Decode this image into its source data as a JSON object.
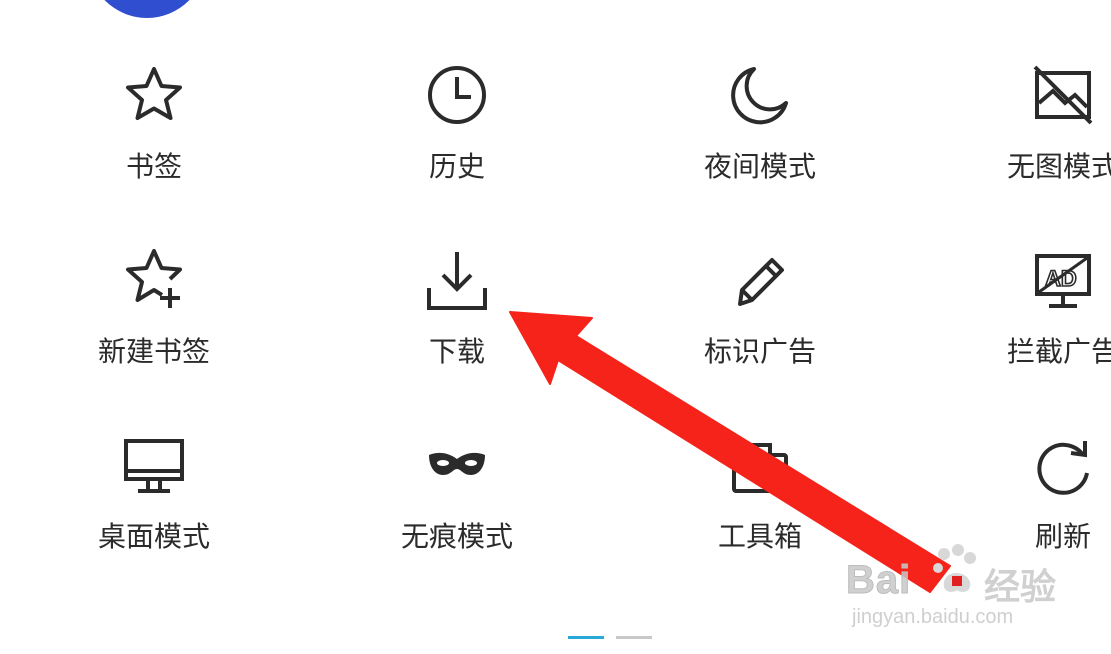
{
  "menu": {
    "items": [
      {
        "label": "书签",
        "icon": "star-icon"
      },
      {
        "label": "历史",
        "icon": "clock-icon"
      },
      {
        "label": "夜间模式",
        "icon": "moon-icon"
      },
      {
        "label": "无图模式",
        "icon": "no-image-icon"
      },
      {
        "label": "新建书签",
        "icon": "star-plus-icon"
      },
      {
        "label": "下载",
        "icon": "download-icon"
      },
      {
        "label": "标识广告",
        "icon": "pencil-icon"
      },
      {
        "label": "拦截广告",
        "icon": "ad-block-icon"
      },
      {
        "label": "桌面模式",
        "icon": "monitor-icon"
      },
      {
        "label": "无痕模式",
        "icon": "mask-icon"
      },
      {
        "label": "工具箱",
        "icon": "toolbox-icon"
      },
      {
        "label": "刷新",
        "icon": "refresh-icon"
      }
    ]
  },
  "pager": {
    "pages": 2,
    "current": 1
  },
  "watermark": {
    "brand": "Bai",
    "brand_cn": "经验",
    "url": "jingyan.baidu.com"
  },
  "colors": {
    "arrow": "#f5231a",
    "avatar": "#2f4fd0",
    "pager_active": "#2aa8d8",
    "pager_inactive": "#c8c8c8"
  }
}
